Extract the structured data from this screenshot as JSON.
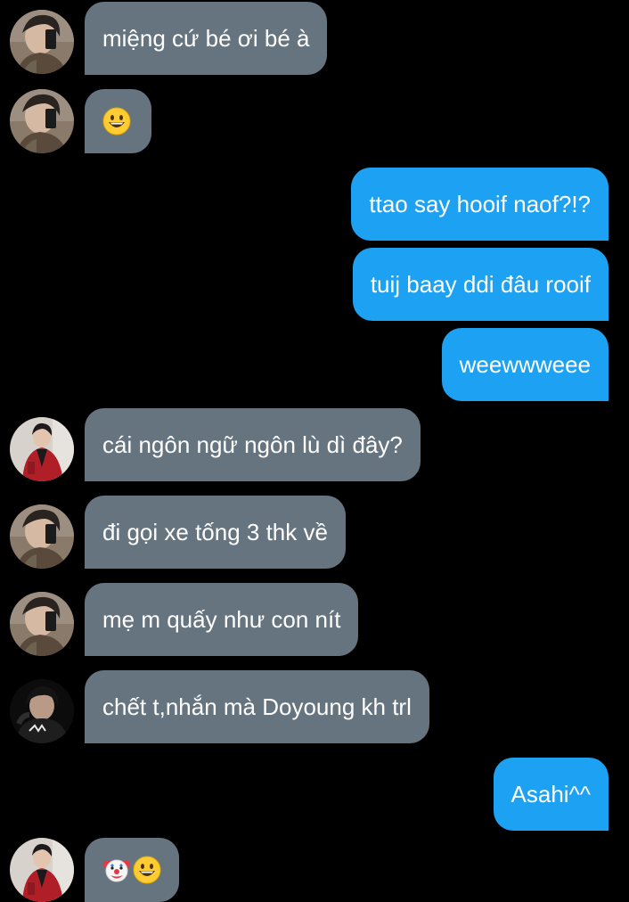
{
  "conversation": {
    "messages": [
      {
        "text": "miệng cứ bé ơi bé à",
        "direction": "incoming",
        "avatar": "mirror-selfie-avatar"
      },
      {
        "text": "",
        "emoji": [
          "grinning-face-icon"
        ],
        "direction": "incoming",
        "avatar": "mirror-selfie-avatar"
      },
      {
        "text": "ttao say hooif naof?!?",
        "direction": "outgoing"
      },
      {
        "text": "tuij baay ddi đâu rooif",
        "direction": "outgoing"
      },
      {
        "text": "weewwweee",
        "direction": "outgoing"
      },
      {
        "text": "cái ngôn ngữ ngôn lù dì đây?",
        "direction": "incoming",
        "avatar": "red-jacket-avatar"
      },
      {
        "text": "đi gọi xe tống 3 thk về",
        "direction": "incoming",
        "avatar": "mirror-selfie-avatar"
      },
      {
        "text": "mẹ m quấy như con nít",
        "direction": "incoming",
        "avatar": "mirror-selfie-avatar"
      },
      {
        "text": "chết t,nhắn mà Doyoung kh trl",
        "direction": "incoming",
        "avatar": "dark-hoodie-avatar"
      },
      {
        "text": "Asahi^^",
        "direction": "outgoing"
      },
      {
        "text": "",
        "emoji": [
          "clown-face-icon",
          "grinning-face-icon"
        ],
        "direction": "incoming",
        "avatar": "red-jacket-avatar"
      }
    ]
  },
  "colors": {
    "background": "#000000",
    "incoming_bubble": "#66747f",
    "outgoing_bubble": "#1da1f2",
    "text": "#ffffff"
  }
}
